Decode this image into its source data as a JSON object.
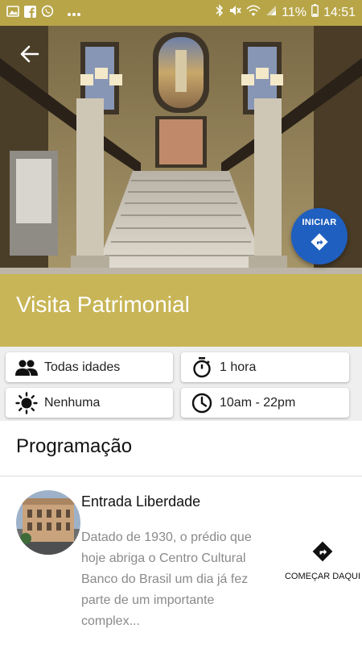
{
  "status_bar": {
    "battery": "11%",
    "time": "14:51",
    "left_icons": [
      "image-icon",
      "facebook-icon",
      "whatsapp-icon",
      "more-dots-icon"
    ],
    "right_icons": [
      "bluetooth-icon",
      "mute-icon",
      "wifi-icon",
      "signal-icon",
      "battery-icon"
    ]
  },
  "header": {
    "back_icon": "arrow-left-icon",
    "start_button": {
      "label": "INICIAR",
      "icon": "directions-icon"
    }
  },
  "title": "Visita Patrimonial",
  "info_cards": [
    {
      "icon": "people-icon",
      "text": "Todas idades"
    },
    {
      "icon": "timer-icon",
      "text": "1 hora"
    },
    {
      "icon": "sun-icon",
      "text": "Nenhuma"
    },
    {
      "icon": "clock-icon",
      "text": "10am - 22pm"
    }
  ],
  "programacao": {
    "heading": "Programação",
    "items": [
      {
        "title": "Entrada Liberdade",
        "description": "Datado de 1930, o prédio que hoje abriga o Centro Cultural Banco do Brasil um dia já fez parte de um importante complex...",
        "action_label": "COMEÇAR DAQUI",
        "action_icon": "directions-icon"
      }
    ]
  },
  "colors": {
    "status_bar": "#b7a548",
    "title_bar": "#c8b557",
    "fab": "#1f5fbf",
    "description_text": "#8a8a8a"
  }
}
